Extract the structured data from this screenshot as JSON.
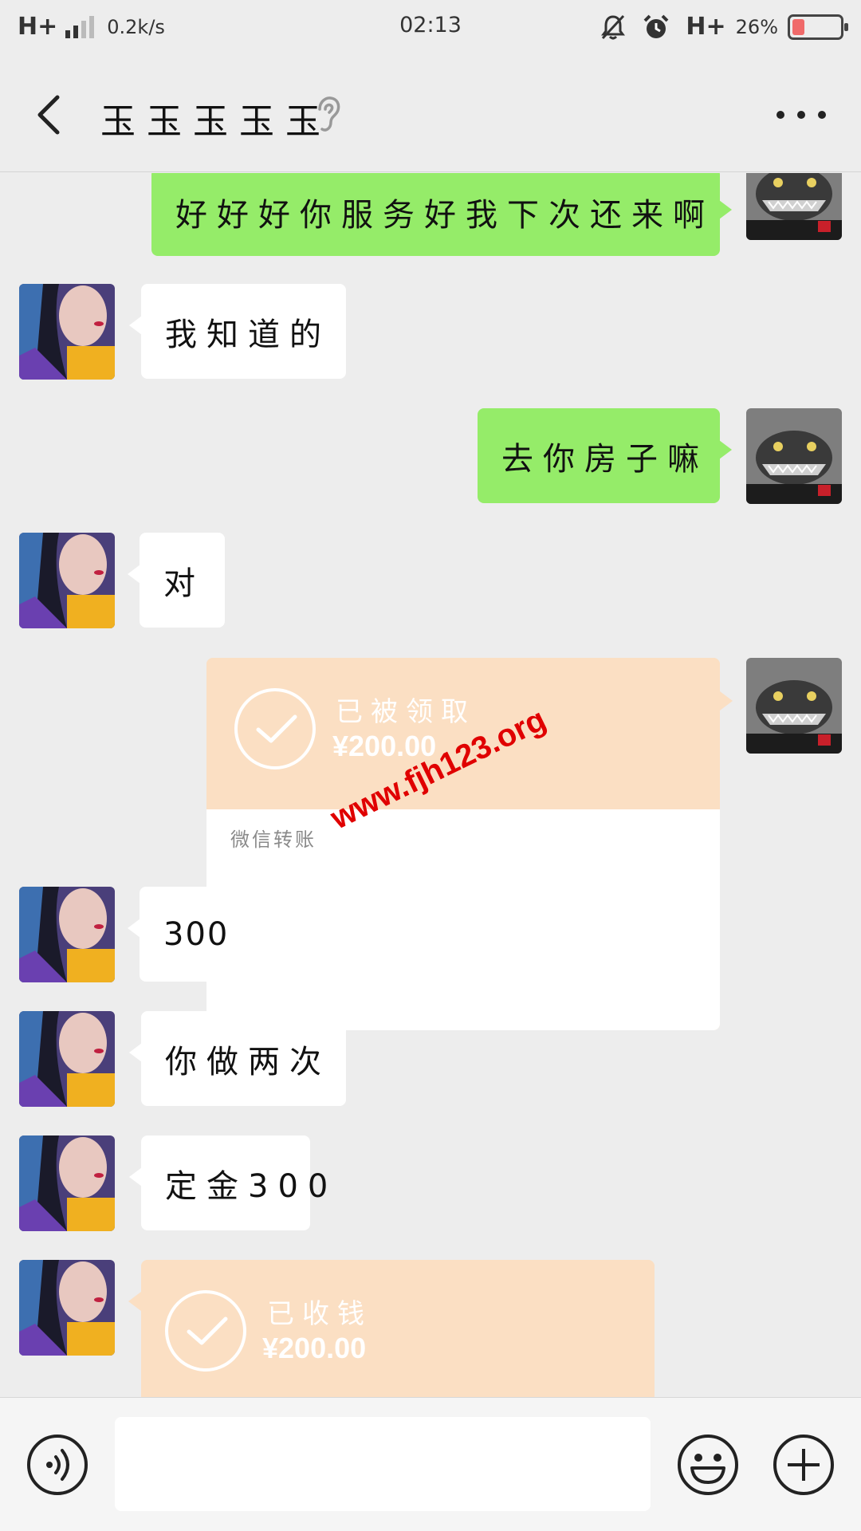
{
  "status_bar": {
    "network_left": "H+",
    "speed": "0.2k/s",
    "time": "02:13",
    "network_right": "H+",
    "battery_percent": "26%",
    "battery_level": 0.26,
    "icons": [
      "signal-icon",
      "mute-icon",
      "alarm-icon",
      "battery-icon"
    ]
  },
  "header": {
    "title": "玉玉玉玉玉",
    "back_icon": "chevron-left-icon",
    "ear_icon": "ear-icon",
    "more_icon": "more-icon"
  },
  "messages": [
    {
      "side": "me",
      "text": "好好好你服务好我下次还来啊"
    },
    {
      "side": "them",
      "text": "我知道的"
    },
    {
      "side": "me",
      "text": "去你房子嘛"
    },
    {
      "side": "them",
      "text": "对"
    },
    {
      "side": "me",
      "type": "transfer",
      "status": "已被领取",
      "amount": "¥200.00",
      "footer": "微信转账"
    },
    {
      "side": "them",
      "text": "300"
    },
    {
      "side": "them",
      "text": "你做两次"
    },
    {
      "side": "them",
      "text": "定金300"
    },
    {
      "side": "them",
      "type": "transfer",
      "status": "已收钱",
      "amount": "¥200.00"
    }
  ],
  "watermark": "www.fjh123.org",
  "colors": {
    "my_bubble": "#95ec69",
    "their_bubble": "#ffffff",
    "transfer_card": "#fbdfc3",
    "background": "#ededed",
    "watermark": "#e00000"
  },
  "input_bar": {
    "placeholder": "",
    "voice_icon": "voice-icon",
    "emoji_icon": "emoji-icon",
    "plus_icon": "plus-icon"
  }
}
